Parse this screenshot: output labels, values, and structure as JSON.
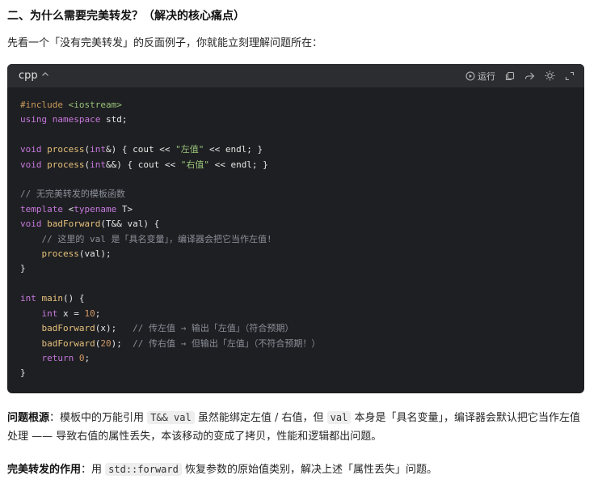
{
  "heading": "二、为什么需要完美转发？（解决的核心痛点）",
  "intro": "先看一个「没有完美转发」的反面例子，你就能立刻理解问题所在：",
  "code_block": {
    "language": "cpp",
    "run_label": "运行",
    "icons": [
      "chevron-up-icon",
      "run-icon",
      "copy-icon",
      "share-icon",
      "theme-icon",
      "expand-icon"
    ],
    "lines": {
      "l1": {
        "pre": "#include",
        "arg": " <iostream>"
      },
      "l2": {
        "using": "using",
        "ns": "namespace",
        "rest": " std;"
      },
      "l4": {
        "t": "void",
        "f": "process",
        "a": "(",
        "at": "int",
        "b": "&) { cout << ",
        "s": "\"左值\"",
        "e": " << endl; }"
      },
      "l5": {
        "t": "void",
        "f": "process",
        "a": "(",
        "at": "int",
        "b": "&&) { cout << ",
        "s": "\"右值\"",
        "e": " << endl; }"
      },
      "l7": "// 无完美转发的模板函数",
      "l8": {
        "tpl": "template",
        "a": " <",
        "tn": "typename",
        "b": " T>"
      },
      "l9": {
        "t": "void",
        "f": "badForward",
        "rest": "(T&& val) {"
      },
      "l10": "    // 这里的 val 是「具名变量」，编译器会把它当作左值!",
      "l11": {
        "indent": "    ",
        "f": "process",
        "rest": "(val);"
      },
      "l12": "}",
      "l14": {
        "t": "int",
        "f": "main",
        "rest": "() {"
      },
      "l15": {
        "indent": "    ",
        "t": "int",
        "a": " x = ",
        "n": "10",
        "b": ";"
      },
      "l16": {
        "indent": "    ",
        "f": "badForward",
        "rest": "(x);   ",
        "c": "// 传左值 → 输出「左值」（符合预期）"
      },
      "l17": {
        "indent": "    ",
        "f": "badForward",
        "a": "(",
        "n": "20",
        "rest": ");  ",
        "c": "// 传右值 → 但输出「左值」（不符合预期！）"
      },
      "l18": {
        "indent": "    ",
        "r": "return",
        "a": " ",
        "n": "0",
        "b": ";"
      },
      "l19": "}"
    }
  },
  "para1": {
    "bold": "问题根源",
    "t1": "：模板中的万能引用 ",
    "code1": "T&& val",
    "t2": " 虽然能绑定左值 / 右值，但 ",
    "code2": "val",
    "t3": " 本身是「具名变量」，编译器会默认把它当作左值处理 —— 导致右值的属性丢失，本该移动的变成了拷贝，性能和逻辑都出问题。"
  },
  "para2": {
    "bold": "完美转发的作用",
    "t1": "：用 ",
    "code1": "std::forward",
    "t2": " 恢复参数的原始值类别，解决上述「属性丢失」问题。"
  }
}
